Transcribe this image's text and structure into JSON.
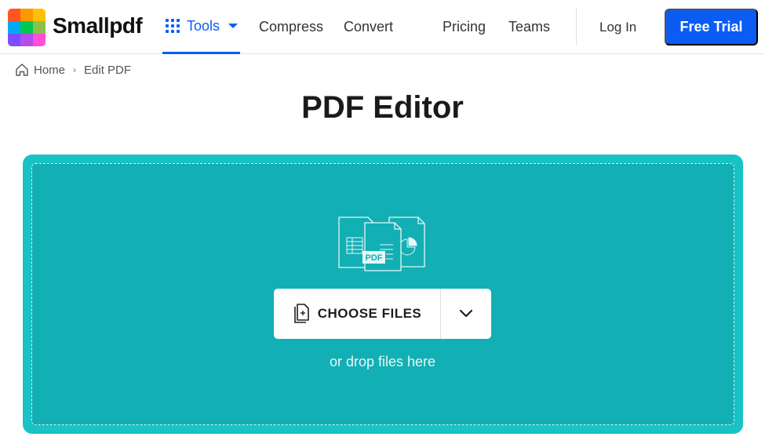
{
  "header": {
    "brand": "Smallpdf",
    "logo_colors": [
      "#ff5722",
      "#ff9800",
      "#ffc107",
      "#03a9f4",
      "#00c853",
      "#8bc34a",
      "#7c4dff",
      "#b44cf0",
      "#ff4fd8"
    ],
    "nav": {
      "tools_label": "Tools",
      "compress_label": "Compress",
      "convert_label": "Convert",
      "pricing_label": "Pricing",
      "teams_label": "Teams"
    },
    "login_label": "Log In",
    "free_trial_label": "Free Trial",
    "accent_color": "#0a5cf5"
  },
  "breadcrumb": {
    "home_label": "Home",
    "separator": "›",
    "current_label": "Edit PDF"
  },
  "page": {
    "title": "PDF Editor"
  },
  "dropzone": {
    "illustration_badge": "PDF",
    "choose_files_label": "CHOOSE FILES",
    "drop_hint": "or drop files here",
    "color": "#12afb4"
  }
}
